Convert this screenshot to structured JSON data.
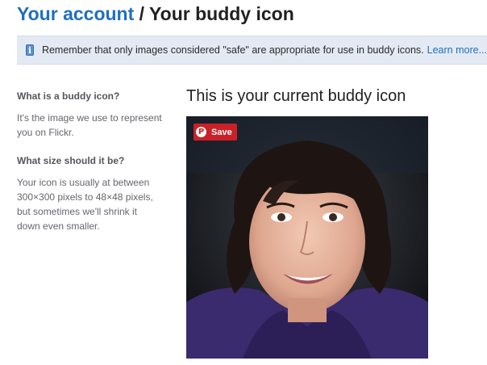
{
  "header": {
    "breadcrumb_link": "Your account",
    "separator": "/",
    "current": "Your buddy icon"
  },
  "notice": {
    "icon": "info-icon",
    "text": "Remember that only images considered \"safe\" are appropriate for use in buddy icons.",
    "link": "Learn more..."
  },
  "sidebar": {
    "q1": "What is a buddy icon?",
    "a1": "It's the image we use to represent you on Flickr.",
    "q2": "What size should it be?",
    "a2": "Your icon is usually at between 300×300 pixels to 48×48 pixels, but sometimes we'll shrink it down even smaller."
  },
  "main": {
    "title": "This is your current buddy icon",
    "save_label": "Save",
    "save_icon": "pinterest-icon"
  },
  "colors": {
    "link": "#1f6fbf",
    "notice_bg": "#e3eaf4",
    "save_bg": "#cb2027"
  }
}
